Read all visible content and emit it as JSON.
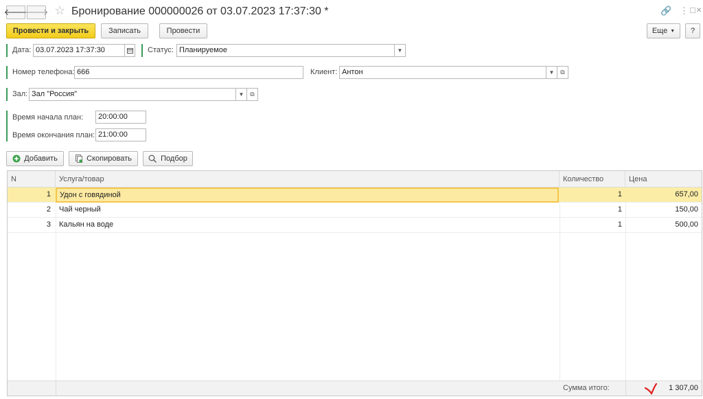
{
  "window": {
    "title": "Бронирование 000000026 от 03.07.2023 17:37:30 *",
    "back_glyph": "🡐",
    "forward_glyph": "🡒",
    "star_glyph": "☆",
    "link_glyph": "🔗",
    "menu_glyph": "⋮",
    "maximize_glyph": "□",
    "close_glyph": "×"
  },
  "toolbar": {
    "post_and_close": "Провести и закрыть",
    "save": "Записать",
    "post": "Провести",
    "more": "Еще",
    "help": "?"
  },
  "form": {
    "date_label": "Дата:",
    "date_value": "03.07.2023 17:37:30",
    "status_label": "Статус:",
    "status_value": "Планируемое",
    "phone_label": "Номер телефона:",
    "phone_value": "666",
    "client_label": "Клиент:",
    "client_value": "Антон",
    "hall_label": "Зал:",
    "hall_value": "Зал \"Россия\"",
    "start_label": "Время начала план:",
    "start_value": "20:00:00",
    "end_label": "Время окончания план:",
    "end_value": "21:00:00"
  },
  "table_toolbar": {
    "add": "Добавить",
    "copy": "Скопировать",
    "pick": "Подбор"
  },
  "table": {
    "columns": [
      "N",
      "Услуга/товар",
      "Количество",
      "Цена"
    ],
    "rows": [
      {
        "n": "1",
        "item": "Удон с говядиной",
        "qty": "1",
        "price": "657,00"
      },
      {
        "n": "2",
        "item": "Чай черный",
        "qty": "1",
        "price": "150,00"
      },
      {
        "n": "3",
        "item": "Кальян на воде",
        "qty": "1",
        "price": "500,00"
      }
    ],
    "total_label": "Сумма итого:",
    "total_value": "1 307,00"
  },
  "colors": {
    "accent_yellow": "#f2cc1b",
    "required_bar": "#3a9a5a",
    "selected_row": "#fbeda6"
  }
}
